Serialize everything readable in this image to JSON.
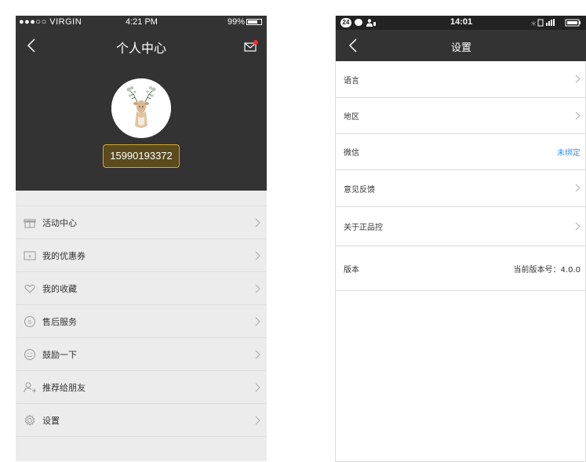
{
  "left_screen": {
    "status_bar": {
      "carrier": "●●●○○ VIRGIN",
      "time": "4:21 PM",
      "battery_text": "99%"
    },
    "header": {
      "title": "个人中心",
      "phone_number": "15990193372"
    },
    "menu": [
      {
        "label": "活动中心",
        "icon": "gift-icon"
      },
      {
        "label": "我的优惠券",
        "icon": "coupon-icon"
      },
      {
        "label": "我的收藏",
        "icon": "heart-icon"
      },
      {
        "label": "售后服务",
        "icon": "service-icon"
      },
      {
        "label": "鼓励一下",
        "icon": "smile-icon"
      },
      {
        "label": "推荐给朋友",
        "icon": "recommend-icon"
      },
      {
        "label": "设置",
        "icon": "gear-icon"
      }
    ],
    "colors": {
      "header_bg": "#333333",
      "pill_border": "#d6a928",
      "mail_badge": "#ff2a2a",
      "list_bg": "#ececec"
    }
  },
  "right_screen": {
    "status_bar": {
      "notification_count": "24",
      "time": "14:01"
    },
    "header": {
      "title": "设置"
    },
    "menu": [
      {
        "label": "语言",
        "value": ""
      },
      {
        "label": "地区",
        "value": ""
      },
      {
        "label": "微信",
        "value": "未绑定"
      },
      {
        "label": "意见反馈",
        "value": ""
      },
      {
        "label": "关于正品控",
        "value": ""
      },
      {
        "label": "版本",
        "value": "当前版本号：4.0.0"
      }
    ],
    "colors": {
      "header_bg": "#333333",
      "link_blue": "#3d8ee8"
    }
  }
}
